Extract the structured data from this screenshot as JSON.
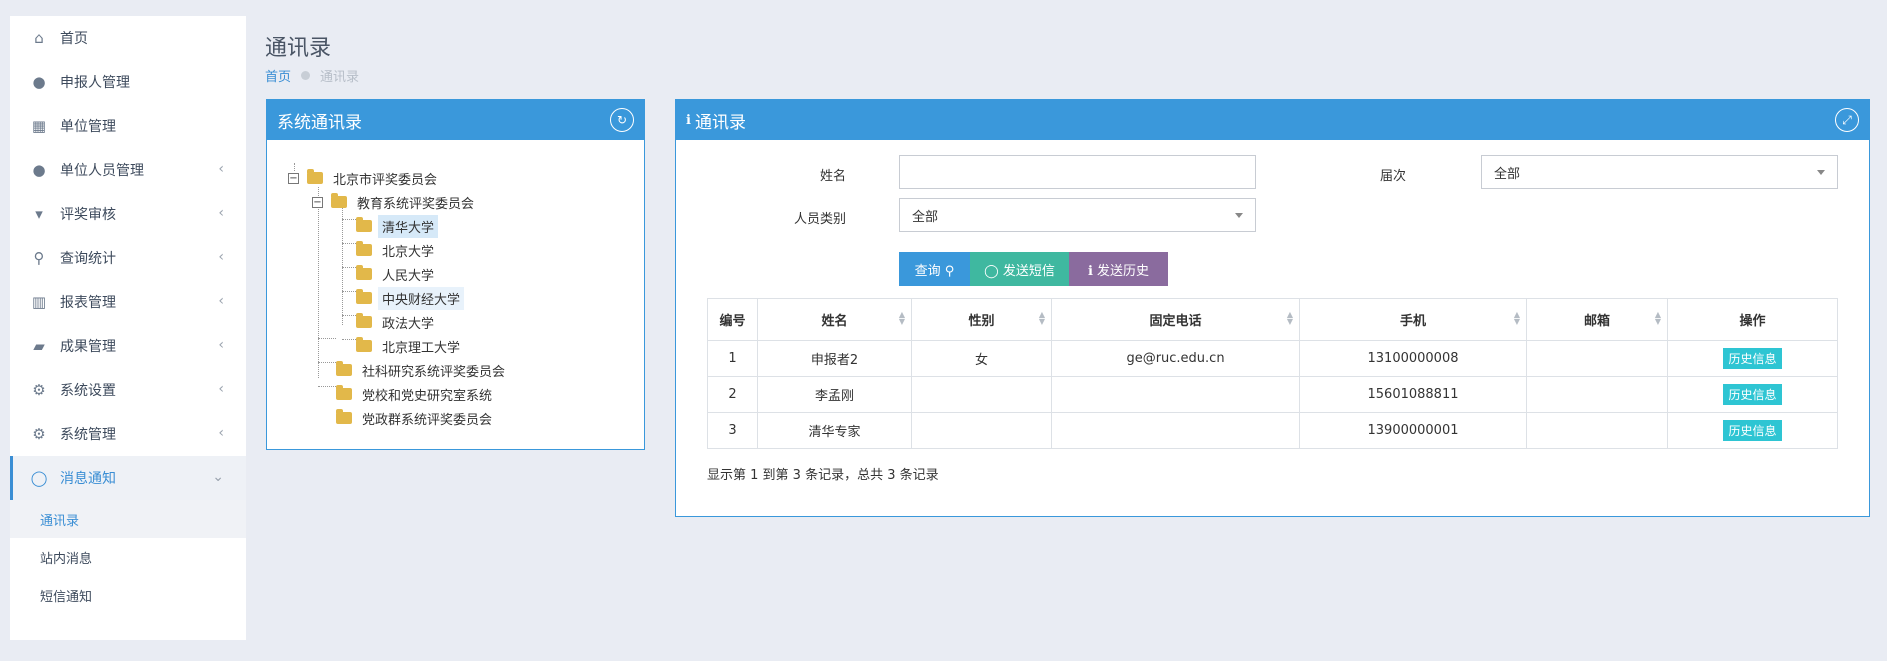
{
  "sidebar": {
    "items": [
      {
        "label": "首页",
        "icon": "home-icon",
        "glyph": "⌂",
        "has_chevron": false
      },
      {
        "label": "申报人管理",
        "icon": "user-icon",
        "glyph": "●",
        "has_chevron": false
      },
      {
        "label": "单位管理",
        "icon": "bank-icon",
        "glyph": "▦",
        "has_chevron": false
      },
      {
        "label": "单位人员管理",
        "icon": "users-icon",
        "glyph": "●",
        "has_chevron": true
      },
      {
        "label": "评奖审核",
        "icon": "trophy-icon",
        "glyph": "▾",
        "has_chevron": true
      },
      {
        "label": "查询统计",
        "icon": "search-icon",
        "glyph": "⚲",
        "has_chevron": true
      },
      {
        "label": "报表管理",
        "icon": "bar-chart-icon",
        "glyph": "▥",
        "has_chevron": true
      },
      {
        "label": "成果管理",
        "icon": "book-icon",
        "glyph": "▰",
        "has_chevron": true
      },
      {
        "label": "系统设置",
        "icon": "cogs-icon",
        "glyph": "⚙",
        "has_chevron": true
      },
      {
        "label": "系统管理",
        "icon": "gear-icon",
        "glyph": "⚙",
        "has_chevron": true
      },
      {
        "label": "消息通知",
        "icon": "comment-icon",
        "glyph": "◯",
        "has_chevron": true
      }
    ],
    "chevron_left": "‹",
    "chevron_down": "⌄",
    "sub_items": [
      "通讯录",
      "站内消息",
      "短信通知"
    ]
  },
  "header": {
    "title": "通讯录",
    "breadcrumb_home": "首页",
    "breadcrumb_current": "通讯录"
  },
  "tree_panel": {
    "title": "系统通讯录",
    "refresh_glyph": "↻",
    "root": "北京市评奖委员会",
    "level1": [
      "教育系统评奖委员会",
      "社科研究系统评奖委员会",
      "党校和党史研究室系统",
      "党政群系统评奖委员会"
    ],
    "level2": [
      "清华大学",
      "北京大学",
      "人民大学",
      "中央财经大学",
      "政法大学",
      "北京理工大学"
    ],
    "minus": "−"
  },
  "main_panel": {
    "title": "通讯录",
    "info_glyph": "ℹ",
    "expand_glyph": "⤢",
    "form": {
      "name_label": "姓名",
      "name_value": "",
      "session_label": "届次",
      "session_value": "全部",
      "category_label": "人员类别",
      "category_value": "全部"
    },
    "buttons": {
      "query": "查询 ⚲",
      "sms": "◯ 发送短信",
      "history": "ℹ 发送历史"
    },
    "colors": {
      "primary": "#3a98db",
      "teal": "#3fb8a0",
      "purple": "#8a6b9e",
      "info": "#2ec5d3"
    },
    "table": {
      "headers": [
        "编号",
        "姓名",
        "性别",
        "固定电话",
        "手机",
        "邮箱",
        "操作"
      ],
      "rows": [
        {
          "id": "1",
          "name": "申报者2",
          "gender": "女",
          "phone": "ge@ruc.edu.cn",
          "mobile": "13100000008",
          "email": "",
          "action": "历史信息"
        },
        {
          "id": "2",
          "name": "李孟刚",
          "gender": "",
          "phone": "",
          "mobile": "15601088811",
          "email": "",
          "action": "历史信息"
        },
        {
          "id": "3",
          "name": "清华专家",
          "gender": "",
          "phone": "",
          "mobile": "13900000001",
          "email": "",
          "action": "历史信息"
        }
      ]
    },
    "summary": "显示第 1 到第 3 条记录，总共 3 条记录"
  }
}
